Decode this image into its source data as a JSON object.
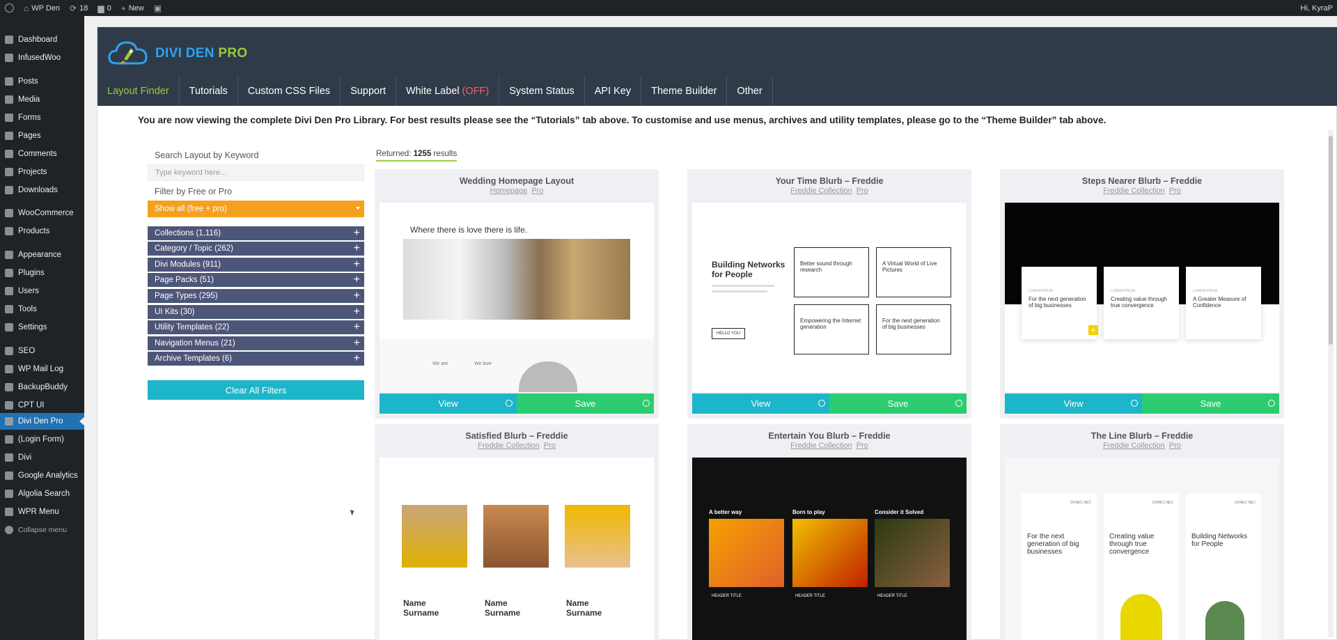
{
  "adminbar": {
    "site_name": "WP Den",
    "updates": "18",
    "comments": "0",
    "new_label": "New",
    "greeting": "Hi, KyraP"
  },
  "sidebar": {
    "items": [
      {
        "label": "Dashboard",
        "icon": "dashboard-icon"
      },
      {
        "label": "InfusedWoo",
        "icon": "infusedwoo-icon"
      },
      {
        "label": "Posts",
        "icon": "pin-icon"
      },
      {
        "label": "Media",
        "icon": "media-icon"
      },
      {
        "label": "Forms",
        "icon": "forms-icon"
      },
      {
        "label": "Pages",
        "icon": "pages-icon"
      },
      {
        "label": "Comments",
        "icon": "comments-icon"
      },
      {
        "label": "Projects",
        "icon": "projects-icon"
      },
      {
        "label": "Downloads",
        "icon": "downloads-icon"
      },
      {
        "label": "WooCommerce",
        "icon": "woocommerce-icon"
      },
      {
        "label": "Products",
        "icon": "products-icon"
      },
      {
        "label": "Appearance",
        "icon": "appearance-icon"
      },
      {
        "label": "Plugins",
        "icon": "plugins-icon"
      },
      {
        "label": "Users",
        "icon": "users-icon"
      },
      {
        "label": "Tools",
        "icon": "tools-icon"
      },
      {
        "label": "Settings",
        "icon": "settings-icon"
      },
      {
        "label": "SEO",
        "icon": "seo-icon"
      },
      {
        "label": "WP Mail Log",
        "icon": "mail-icon"
      },
      {
        "label": "BackupBuddy",
        "icon": "backup-icon"
      },
      {
        "label": "CPT UI",
        "icon": "cpt-icon"
      },
      {
        "label": "Divi Den Pro",
        "icon": "divi-den-icon"
      },
      {
        "label": "(Login Form)",
        "icon": "login-form-icon"
      },
      {
        "label": "Divi",
        "icon": "divi-icon"
      },
      {
        "label": "Google Analytics",
        "icon": "analytics-icon"
      },
      {
        "label": "Algolia Search",
        "icon": "search-icon"
      },
      {
        "label": "WPR Menu",
        "icon": "menu-icon"
      },
      {
        "label": "Collapse menu",
        "icon": "collapse-icon"
      }
    ]
  },
  "header": {
    "logo_part1": "DIVI DEN",
    "logo_part2": "PRO",
    "tabs": [
      {
        "label": "Layout Finder"
      },
      {
        "label": "Tutorials"
      },
      {
        "label": "Custom CSS Files"
      },
      {
        "label": "Support"
      },
      {
        "label": "White Label",
        "suffix": "(OFF)"
      },
      {
        "label": "System Status"
      },
      {
        "label": "API Key"
      },
      {
        "label": "Theme Builder"
      },
      {
        "label": "Other"
      }
    ]
  },
  "intro": "You are now viewing the complete Divi Den Pro Library. For best results please see the “Tutorials” tab above. To customise and use menus, archives and utility templates, please go to the “Theme Builder” tab above.",
  "filters": {
    "search_label": "Search Layout by Keyword",
    "search_placeholder": "Type keyword here...",
    "free_pro_label": "Filter by Free or Pro",
    "free_pro_value": "Show all (free + pro)",
    "accordions": [
      "Collections (1,116)",
      "Category / Topic (262)",
      "Divi Modules (911)",
      "Page Packs (51)",
      "Page Types (295)",
      "UI Kits (30)",
      "Utility Templates (22)",
      "Navigation Menus (21)",
      "Archive Templates (6)"
    ],
    "clear_label": "Clear All Filters"
  },
  "results": {
    "prefix": "Returned:",
    "count": "1255",
    "suffix": "results"
  },
  "cards": [
    {
      "title": "Wedding Homepage Layout",
      "tag1": "Homepage",
      "tag2": "Pro",
      "view": "View",
      "save": "Save"
    },
    {
      "title": "Your Time Blurb – Freddie",
      "tag1": "Freddie Collection",
      "tag2": "Pro",
      "view": "View",
      "save": "Save"
    },
    {
      "title": "Steps Nearer Blurb – Freddie",
      "tag1": "Freddie Collection",
      "tag2": "Pro",
      "view": "View",
      "save": "Save"
    },
    {
      "title": "Satisfied Blurb – Freddie",
      "tag1": "Freddie Collection",
      "tag2": "Pro"
    },
    {
      "title": "Entertain You Blurb – Freddie",
      "tag1": "Freddie Collection",
      "tag2": "Pro"
    },
    {
      "title": "The Line Blurb – Freddie",
      "tag1": "Freddie Collection",
      "tag2": "Pro"
    }
  ],
  "previews": {
    "wedding_tagline": "Where there is love there is life.",
    "wedding_small1": "We are",
    "wedding_small2": "We love",
    "networks_heading": "Building Networks for People",
    "networks_button": "HELLO YOU",
    "networks_boxes": [
      "Better sound through research",
      "A Virtual World of Live Pictures",
      "Empowering the Internet generation",
      "For the next generation of big businesses"
    ],
    "steps_eyebrow": "LOREM IPSUM",
    "steps_boxes": [
      "For the next generation of big businesses",
      "Creating value through true convergence",
      "A Greater Measure of Confidence"
    ],
    "satisfied_name": "Name Surname",
    "entertain_heads": [
      "A better way",
      "Born to play",
      "Consider it Solved"
    ],
    "entertain_label": "HEADER TITLE",
    "line_texts": [
      "For the next generation of big businesses",
      "Creating value through true convergence",
      "Building Networks for People"
    ],
    "line_side": "DONEC NEC"
  },
  "colors": {
    "accent_green": "#9bc93f",
    "accent_blue": "#2ea3f2",
    "view_button": "#1cb5c9",
    "save_button": "#2ecc71",
    "filter_orange": "#f5a11f",
    "accordion": "#4d5678",
    "white_label_off": "#ff5a6a"
  }
}
